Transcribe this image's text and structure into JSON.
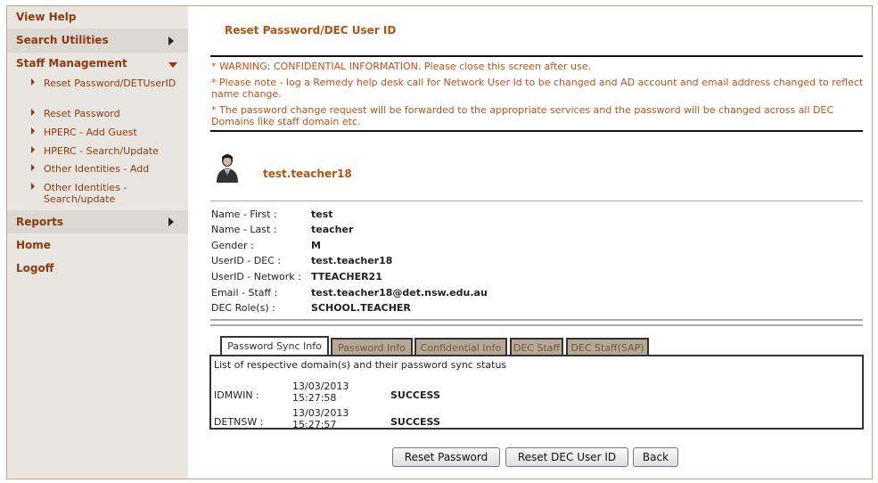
{
  "sidebar": {
    "view_help": "View Help",
    "search_utilities": "Search Utilities",
    "staff_management": "Staff Management",
    "staff_items": [
      "Reset Password/DETUserID",
      "Reset Password",
      "HPERC - Add Guest",
      "HPERC - Search/Update",
      "Other Identities - Add",
      "Other Identities - Search/update"
    ],
    "reports": "Reports",
    "home": "Home",
    "logoff": "Logoff"
  },
  "page": {
    "title": "Reset Password/DEC User ID",
    "warnings": [
      "* WARNING: CONFIDENTIAL INFORMATION. Please close this screen after use.",
      "* Please note - log a Remedy help desk call for Network User Id to be changed and AD account and email address changed to reflect name change.",
      "* The password change request will be forwarded to the appropriate services and the password will be changed across all DEC Domains like staff domain etc."
    ]
  },
  "user": {
    "username": "test.teacher18",
    "fields": [
      {
        "label": "Name - First :",
        "value": "test"
      },
      {
        "label": "Name - Last :",
        "value": "teacher"
      },
      {
        "label": "Gender :",
        "value": "M"
      },
      {
        "label": "UserID - DEC :",
        "value": "test.teacher18"
      },
      {
        "label": "UserID - Network :",
        "value": "TTEACHER21"
      },
      {
        "label": "Email - Staff :",
        "value": "test.teacher18@det.nsw.edu.au"
      },
      {
        "label": "DEC Role(s) :",
        "value": "SCHOOL.TEACHER"
      }
    ]
  },
  "tabs": [
    {
      "label": "Password Sync Info",
      "active": true
    },
    {
      "label": "Password Info",
      "active": false
    },
    {
      "label": "Confidential Info",
      "active": false
    },
    {
      "label": "DEC Staff",
      "active": false
    },
    {
      "label": "DEC Staff(SAP)",
      "active": false
    }
  ],
  "sync": {
    "description": "List of respective domain(s) and their password sync status",
    "rows": [
      {
        "domain": "IDMWIN :",
        "date": "13/03/2013",
        "time": "15:27:58",
        "status": "SUCCESS"
      },
      {
        "domain": "DETNSW :",
        "date": "13/03/2013",
        "time": "15:27:57",
        "status": "SUCCESS"
      }
    ]
  },
  "buttons": {
    "reset_password": "Reset Password",
    "reset_dec_user_id": "Reset DEC User ID",
    "back": "Back"
  },
  "colors": {
    "accent": "#b5530f",
    "warning": "#c0511a",
    "sidebar_bg": "#e9e6e1",
    "tab_inactive_bg": "#b5a995"
  }
}
